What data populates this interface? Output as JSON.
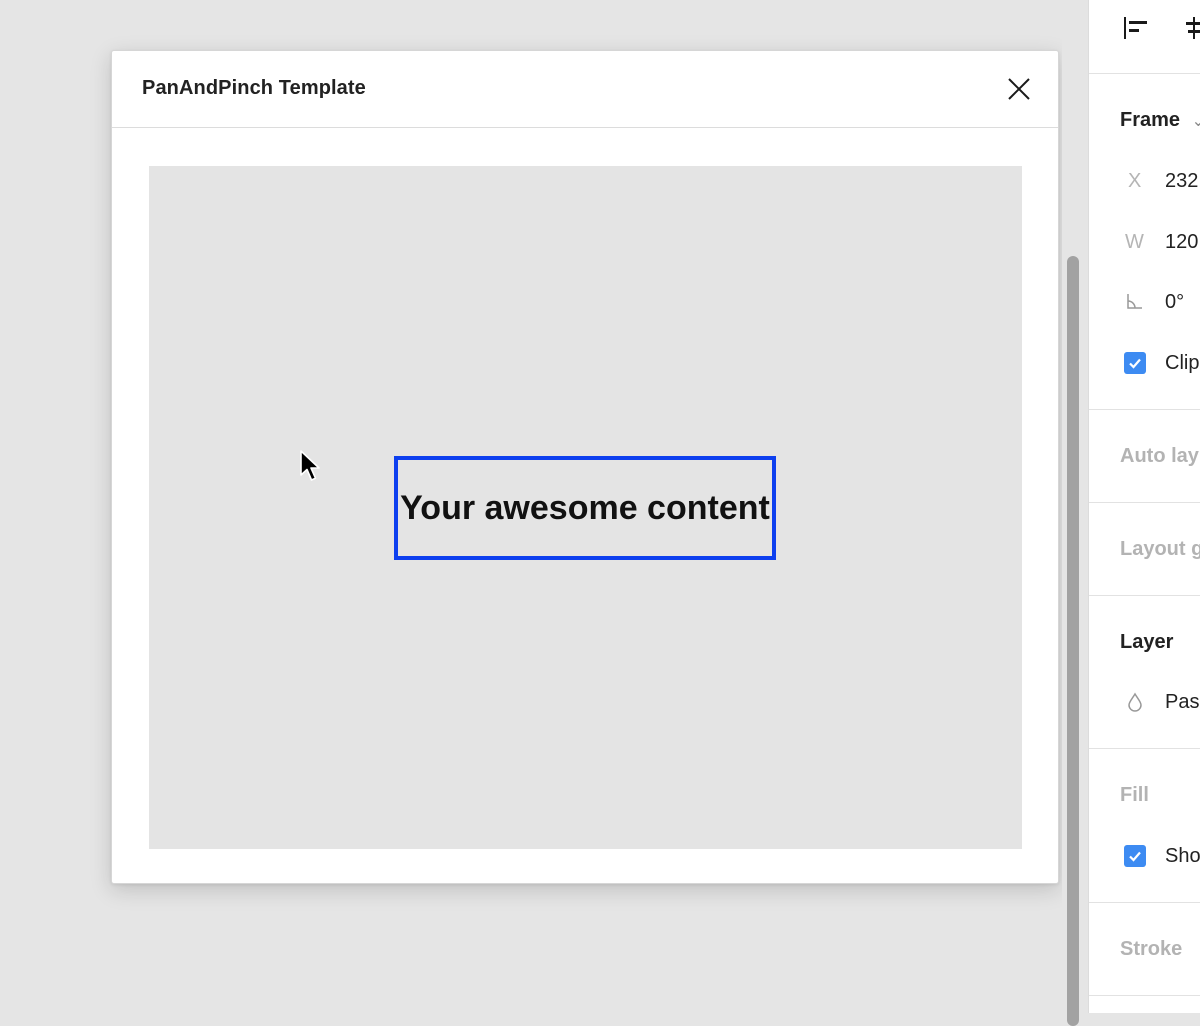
{
  "modal": {
    "title": "PanAndPinch Template",
    "content_text": "Your awesome content"
  },
  "panel": {
    "frame": {
      "title": "Frame",
      "chevron": "⌄"
    },
    "x": {
      "label": "X",
      "value": "232"
    },
    "w": {
      "label": "W",
      "value": "120"
    },
    "rotation": {
      "value": "0°"
    },
    "clip": {
      "label": "Clip",
      "checked": true
    },
    "auto_layout": {
      "title": "Auto lay"
    },
    "layout_grid": {
      "title": "Layout g"
    },
    "layer": {
      "title": "Layer",
      "blend_value": "Pas"
    },
    "fill": {
      "title": "Fill"
    },
    "show": {
      "label": "Sho",
      "checked": true
    },
    "stroke": {
      "title": "Stroke"
    }
  },
  "colors": {
    "selection": "#0d3fef",
    "checkbox": "#3d8bf2"
  },
  "icons": [
    "close-icon",
    "align-left-icon",
    "align-center-icon",
    "chevron-down-icon",
    "rotation-icon",
    "checkmark-icon",
    "drop-icon",
    "mouse-cursor-icon"
  ]
}
